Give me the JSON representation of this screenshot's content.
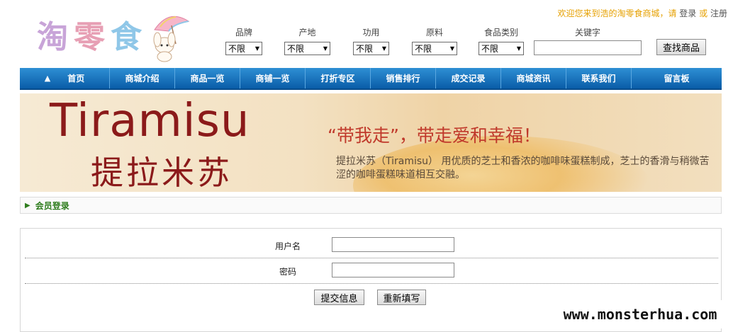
{
  "header": {
    "logo_chars": [
      "淘",
      "零",
      "食"
    ],
    "welcome_text": "欢迎您来到浩的淘零食商城，请",
    "login_link": "登录",
    "or_text": "或",
    "register_link": "注册"
  },
  "filters": [
    {
      "label": "品牌",
      "value": "不限"
    },
    {
      "label": "产地",
      "value": "不限"
    },
    {
      "label": "功用",
      "value": "不限"
    },
    {
      "label": "原料",
      "value": "不限"
    },
    {
      "label": "食品类别",
      "value": "不限"
    }
  ],
  "search": {
    "keyword_label": "关键字",
    "keyword_value": "",
    "button_label": "查找商品"
  },
  "nav": {
    "items": [
      "首页",
      "商城介绍",
      "商品一览",
      "商铺一览",
      "打折专区",
      "销售排行",
      "成交记录",
      "商城资讯",
      "联系我们",
      "留言板"
    ]
  },
  "banner": {
    "title_en": "Tiramisu",
    "title_cn": "提拉米苏",
    "slogan": "“带我走”，带走爱和幸福！",
    "description": "提拉米苏（Tiramisu） 用优质的芝士和香浓的咖啡味蛋糕制成，芝士的香滑与稍微苦涩的咖啡蛋糕味道相互交融。"
  },
  "member_login": {
    "section_title": "会员登录",
    "username_label": "用户名",
    "username_value": "",
    "password_label": "密码",
    "password_value": "",
    "submit_label": "提交信息",
    "reset_label": "重新填写"
  },
  "watermark": "www.monsterhua.com",
  "colors": {
    "nav_bg": "#0a5da8",
    "welcome_text": "#e6a000",
    "section_title": "#2f7d1e",
    "banner_text": "#8b1a1a"
  }
}
